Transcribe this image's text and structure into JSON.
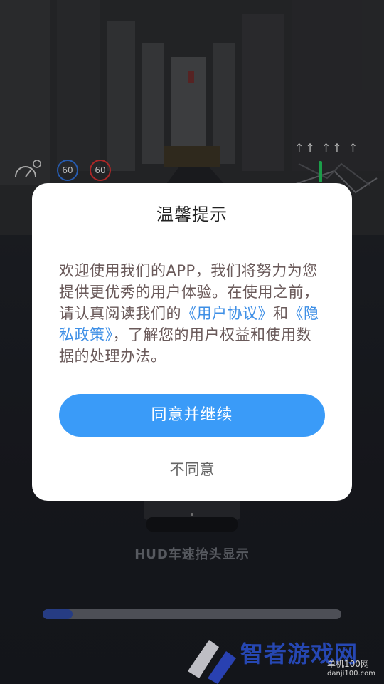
{
  "background": {
    "speed_limit_1": "60",
    "speed_limit_2": "60",
    "device_caption": "HUD车速抬头显示",
    "progress": 0.1
  },
  "dialog": {
    "title": "温馨提示",
    "body_part1": "欢迎使用我们的APP，我们将努力为您提供更优秀的用户体验。在使用之前，请认真阅读我们的",
    "user_agreement_link": "《用户协议》",
    "and_text": "和",
    "privacy_policy_link": "《隐私政策》",
    "body_part2": "，了解您的用户权益和使用数据的处理办法。",
    "agree_label": "同意并继续",
    "disagree_label": "不同意"
  },
  "watermark": {
    "brand": "智者游戏网",
    "site_label": "单机100网",
    "site_url": "danji100.com"
  },
  "colors": {
    "accent": "#3a9bf8",
    "link": "#3e8fe6",
    "progress_fill": "#2f4aa0"
  }
}
